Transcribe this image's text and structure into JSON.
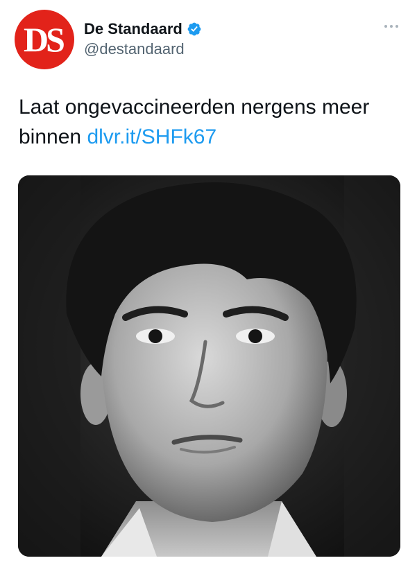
{
  "account": {
    "avatar_logo": "DS",
    "display_name": "De Standaard",
    "handle": "@destandaard",
    "verified": true
  },
  "tweet": {
    "text": "Laat ongevaccineerden nergens meer binnen",
    "link": "dlvr.it/SHFk67"
  },
  "media": {
    "description_icon": "portrait-photo"
  },
  "colors": {
    "brand_red": "#e2231a",
    "link_blue": "#1d9bf0",
    "verified_blue": "#1d9bf0",
    "secondary_text": "#536471"
  }
}
